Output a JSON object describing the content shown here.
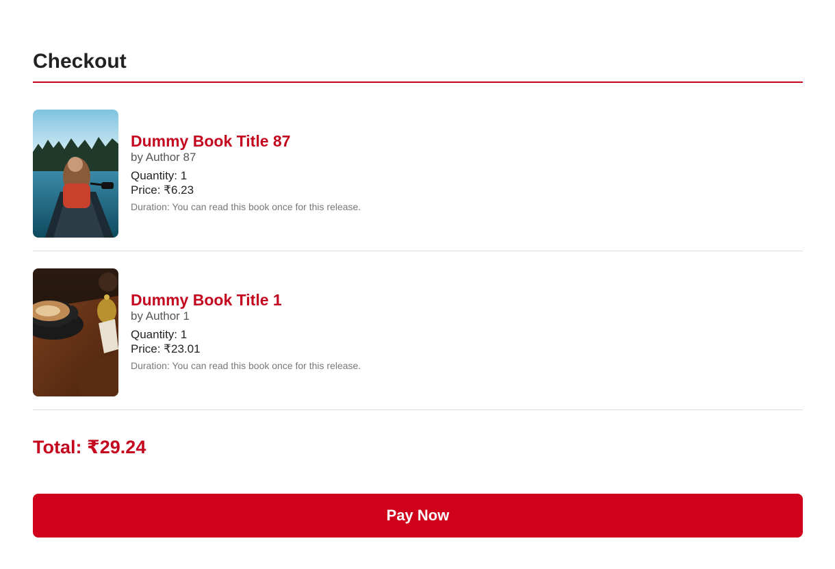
{
  "page": {
    "title": "Checkout"
  },
  "cart": {
    "items": [
      {
        "title": "Dummy Book Title 87",
        "author": "by Author 87",
        "quantity": "Quantity: 1",
        "price": "Price: ₹6.23",
        "duration": "Duration: You can read this book once for this release.",
        "cover_icon": "lake-canoe-photo"
      },
      {
        "title": "Dummy Book Title 1",
        "author": "by Author 1",
        "quantity": "Quantity: 1",
        "price": "Price: ₹23.01",
        "duration": "Duration: You can read this book once for this release.",
        "cover_icon": "coffee-cup-photo"
      }
    ],
    "total": "Total: ₹29.24"
  },
  "actions": {
    "pay_label": "Pay Now"
  },
  "colors": {
    "accent": "#c4071f",
    "button": "#d0021b",
    "divider": "#dddddd"
  }
}
